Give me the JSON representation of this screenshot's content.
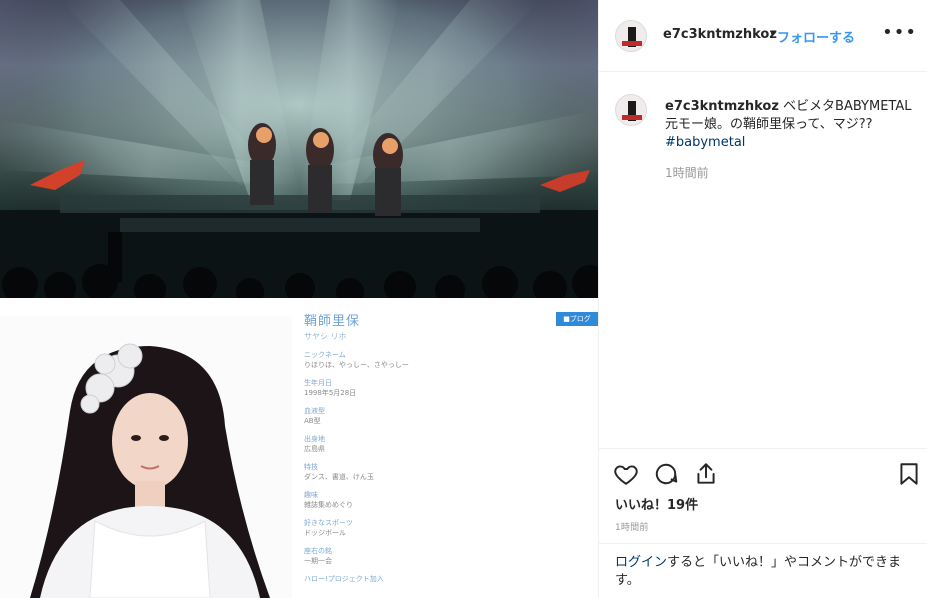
{
  "post": {
    "username": "e7c3kntmzhkoz",
    "dot": "•",
    "follow_label": "フォローする",
    "more_icon": "more-horizontal-icon",
    "caption_username": "e7c3kntmzhkoz",
    "caption_text": "ベビメタBABYMETAL 元モー娘。の鞘師里保って、マジ??",
    "hashtag": "#babymetal",
    "comment_time": "1時間前",
    "likes": "いいね！19件",
    "time": "1時間前",
    "login_link": "ログイン",
    "login_text": "すると「いいね！」やコメントができます。"
  },
  "profile_card": {
    "name": "鞘師里保",
    "kana": "サヤシ リホ",
    "badge": "■ブログ",
    "rows": [
      {
        "label": "ニックネーム",
        "value": "りほりほ、やっしー、さやっしー"
      },
      {
        "label": "生年月日",
        "value": "1998年5月28日"
      },
      {
        "label": "血液型",
        "value": "AB型"
      },
      {
        "label": "出身地",
        "value": "広島県"
      },
      {
        "label": "特技",
        "value": "ダンス、書道、けん玉"
      },
      {
        "label": "趣味",
        "value": "雑誌集めめぐり"
      },
      {
        "label": "好きなスポーツ",
        "value": "ドッジボール"
      },
      {
        "label": "座右の銘",
        "value": "一期一会"
      },
      {
        "label": "ハロー!プロジェクト加入",
        "value": ""
      }
    ]
  },
  "colors": {
    "link": "#3897f0",
    "hashtag": "#003569",
    "border": "#efefef",
    "muted": "#999999"
  },
  "icons": {
    "like": "heart-icon",
    "comment": "comment-icon",
    "share": "share-icon",
    "save": "bookmark-icon"
  }
}
